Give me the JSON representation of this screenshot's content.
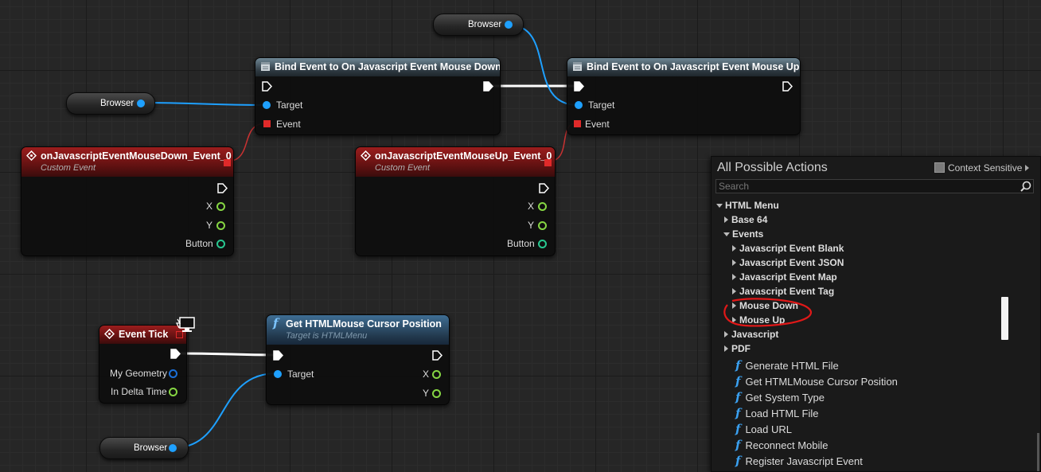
{
  "nodes": {
    "bind_down": {
      "title": "Bind Event to On Javascript Event Mouse Down",
      "target": "Target",
      "event": "Event"
    },
    "bind_up": {
      "title": "Bind Event to On Javascript Event Mouse Up",
      "target": "Target",
      "event": "Event"
    },
    "event_down": {
      "title": "onJavascriptEventMouseDown_Event_0",
      "subtitle": "Custom Event",
      "x": "X",
      "y": "Y",
      "button": "Button"
    },
    "event_up": {
      "title": "onJavascriptEventMouseUp_Event_0",
      "subtitle": "Custom Event",
      "x": "X",
      "y": "Y",
      "button": "Button"
    },
    "event_tick": {
      "title": "Event Tick",
      "my_geometry": "My Geometry",
      "in_delta_time": "In Delta Time"
    },
    "get_cursor": {
      "title": "Get HTMLMouse Cursor Position",
      "subtitle": "Target is HTMLMenu",
      "target": "Target",
      "x": "X",
      "y": "Y"
    },
    "var_browser_1": "Browser",
    "var_browser_2": "Browser",
    "var_browser_3": "Browser"
  },
  "panel": {
    "title": "All Possible Actions",
    "context_sensitive": "Context Sensitive",
    "search_placeholder": "Search",
    "tree": {
      "html_menu": "HTML Menu",
      "base64": "Base 64",
      "events": "Events",
      "js_event_blank": "Javascript Event Blank",
      "js_event_json": "Javascript Event JSON",
      "js_event_map": "Javascript Event Map",
      "js_event_tag": "Javascript Event Tag",
      "mouse_down": "Mouse Down",
      "mouse_up": "Mouse Up",
      "javascript": "Javascript",
      "pdf": "PDF"
    },
    "functions": [
      "Generate HTML File",
      "Get HTMLMouse Cursor Position",
      "Get System Type",
      "Load HTML File",
      "Load URL",
      "Reconnect Mobile",
      "Register Javascript Event"
    ]
  },
  "colors": {
    "object_pin": "#1ea0ff",
    "delegate_pin": "#e02a2a",
    "float_pin": "#86d643",
    "annotation": "#e01818"
  }
}
